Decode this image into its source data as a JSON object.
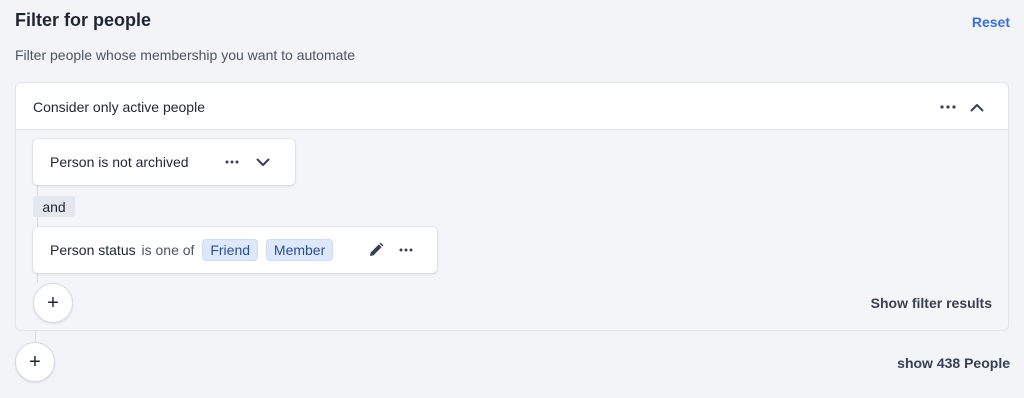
{
  "header": {
    "title": "Filter for people",
    "reset_label": "Reset",
    "subtitle": "Filter people whose membership you want to automate"
  },
  "group": {
    "title": "Consider only active people",
    "more_icon": "more-horizontal-icon",
    "collapse_icon": "chevron-up-icon",
    "conditions": [
      {
        "text": "Person is not archived",
        "more_icon": "more-horizontal-icon",
        "expand_icon": "chevron-down-icon"
      },
      {
        "field": "Person status",
        "operator": "is one of",
        "values": [
          "Friend",
          "Member"
        ],
        "edit_icon": "pencil-icon",
        "more_icon": "more-horizontal-icon"
      }
    ],
    "joiner": "and",
    "add_icon": "+",
    "show_results_label": "Show filter results"
  },
  "footer": {
    "add_icon": "+",
    "show_people_label": "show 438 People"
  },
  "colors": {
    "accent": "#3b6fd8",
    "chip_bg": "#dde8fa",
    "chip_text": "#2b4f8f",
    "page_bg": "#f2f4f7"
  }
}
